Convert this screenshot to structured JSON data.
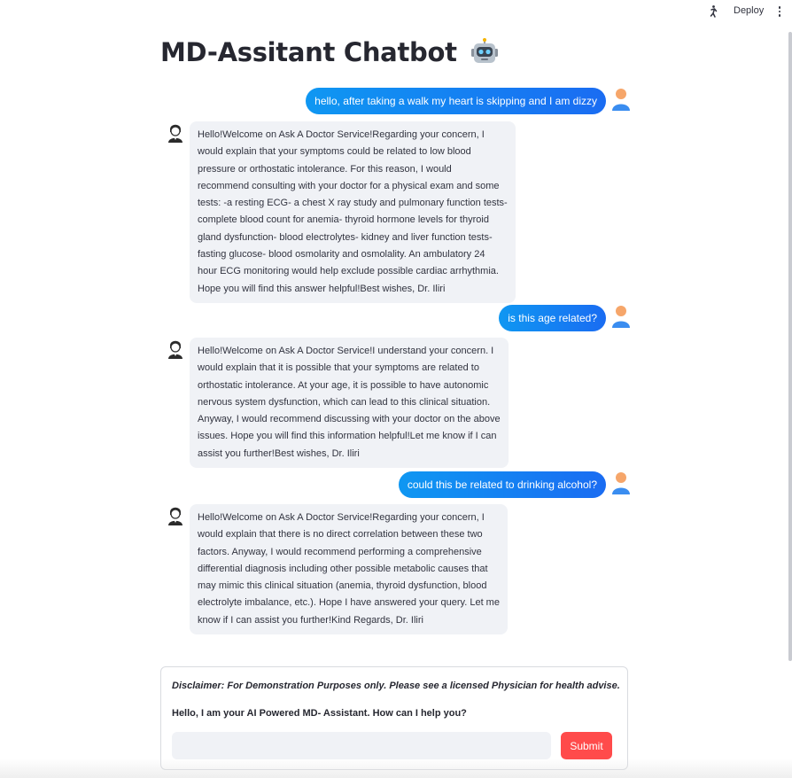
{
  "toolbar": {
    "deploy_label": "Deploy",
    "icons": [
      "running-icon",
      "more-vertical-icon"
    ]
  },
  "page": {
    "title": "MD-Assitant Chatbot",
    "title_icon": "robot-face-emoji"
  },
  "messages": [
    {
      "role": "user",
      "text": "hello, after taking a walk my heart is skipping and I am dizzy"
    },
    {
      "role": "assistant",
      "lines": [
        "Hello!Welcome on Ask A Doctor Service!Regarding your concern, I",
        "would explain that your symptoms could be related to low blood",
        "pressure or orthostatic intolerance. For this reason, I would",
        "recommend consulting with your doctor for a physical exam and some",
        "tests: -a resting ECG- a chest X ray study and pulmonary function tests-",
        "complete blood count for anemia- thyroid hormone levels for thyroid",
        "gland dysfunction- blood electrolytes- kidney and liver function tests-",
        "fasting glucose- blood osmolarity and osmolality. An ambulatory 24",
        "hour ECG monitoring would help exclude possible cardiac arrhythmia.",
        "Hope you will find this answer helpful!Best wishes, Dr. Iliri"
      ]
    },
    {
      "role": "user",
      "text": "is this age related?"
    },
    {
      "role": "assistant",
      "lines": [
        "Hello!Welcome on Ask A Doctor Service!I understand your concern. I",
        "would explain that it is possible that your symptoms are related to",
        "orthostatic intolerance. At your age, it is possible to have autonomic",
        "nervous system dysfunction, which can lead to this clinical situation.",
        "Anyway, I would recommend discussing with your doctor on the above",
        "issues. Hope you will find this information helpful!Let me know if I can",
        "assist you further!Best wishes, Dr. Iliri"
      ]
    },
    {
      "role": "user",
      "text": "could this be related to drinking alcohol?"
    },
    {
      "role": "assistant",
      "lines": [
        "Hello!Welcome on Ask A Doctor Service!Regarding your concern, I",
        "would explain that there is no direct correlation between these two",
        "factors. Anyway, I would recommend performing a comprehensive",
        "differential diagnosis including other possible metabolic causes that",
        "may mimic this clinical situation (anemia, thyroid dysfunction, blood",
        "electrolyte imbalance, etc.). Hope I have answered your query. Let me",
        "know if I can assist you further!Kind Regards, Dr. Iliri"
      ]
    }
  ],
  "form": {
    "disclaimer": "Disclaimer: For Demonstration Purposes only. Please see a licensed Physician for health advise.",
    "greeting": "Hello, I am your AI Powered MD- Assistant. How can I help you?",
    "input_value": "",
    "input_placeholder": "",
    "submit_label": "Submit"
  },
  "colors": {
    "user_bubble": "#1a82f2",
    "bot_bubble": "#f0f2f6",
    "submit": "#ff4b4b",
    "text": "#31333f"
  }
}
